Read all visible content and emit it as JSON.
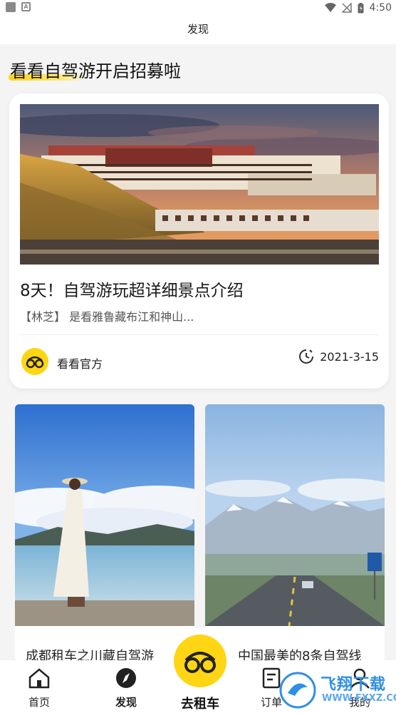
{
  "status_bar": {
    "time": "4:50"
  },
  "header": {
    "title": "发现"
  },
  "section": {
    "title": "看看自驾游开启招募啦"
  },
  "featured": {
    "title": "8天！自驾游玩超详细景点介绍",
    "subtitle": "【林芝】 是看雅鲁藏布江和神山...",
    "author": "看看官方",
    "date": "2021-3-15"
  },
  "grid": [
    {
      "title": "成都租车之川藏自驾游"
    },
    {
      "title": "中国最美的8条自驾线"
    }
  ],
  "bottom_nav": {
    "home": "首页",
    "discover": "发现",
    "rent": "去租车",
    "orders": "订单",
    "mine": "我的"
  },
  "watermark": {
    "text": "飞翔下载",
    "sub": "WWW.FXXZ.COM"
  },
  "colors": {
    "accent": "#ffd514",
    "background": "#f4f4f4"
  }
}
